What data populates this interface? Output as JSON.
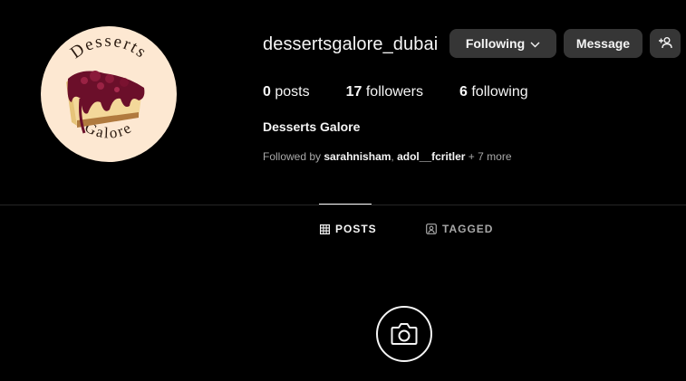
{
  "profile": {
    "username": "dessertsgalore_dubai",
    "full_name": "Desserts Galore",
    "avatar_text_top": "Desserts",
    "avatar_text_bottom": "Galore"
  },
  "actions": {
    "following_label": "Following",
    "message_label": "Message"
  },
  "stats": {
    "posts_count": "0",
    "posts_label": "posts",
    "followers_count": "17",
    "followers_label": "followers",
    "following_count": "6",
    "following_label": "following"
  },
  "followed_by": {
    "prefix": "Followed by ",
    "user1": "sarahnisham",
    "separator": ", ",
    "user2": "adol__fcritler",
    "more": " + 7 more"
  },
  "tabs": {
    "posts": "POSTS",
    "tagged": "TAGGED"
  },
  "colors": {
    "background": "#000000",
    "button": "#363636",
    "text": "#f5f5f5",
    "muted": "#a8a8a8",
    "avatar_bg": "#fde8d2"
  },
  "icons": {
    "following_chevron": "chevron-down-icon",
    "add_user": "person-add-icon",
    "posts_tab": "grid-icon",
    "tagged_tab": "tag-user-icon",
    "empty_state": "camera-icon"
  }
}
